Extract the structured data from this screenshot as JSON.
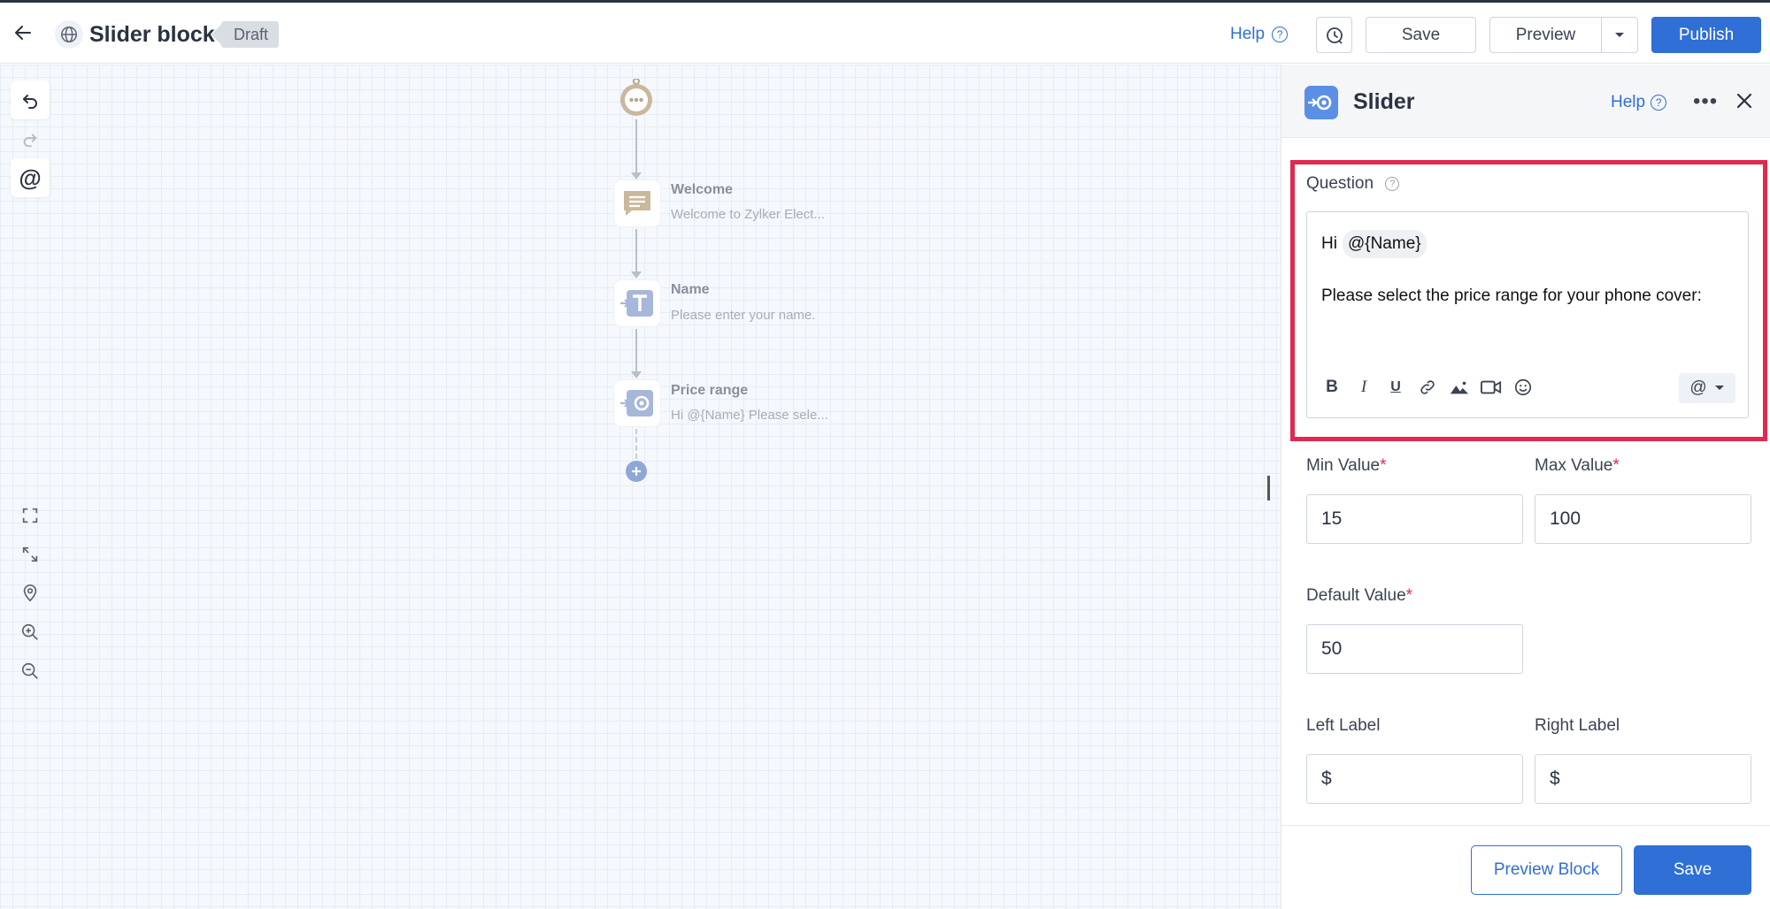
{
  "header": {
    "title": "Slider block",
    "status": "Draft",
    "help_label": "Help",
    "save_label": "Save",
    "preview_label": "Preview",
    "publish_label": "Publish"
  },
  "flow": {
    "nodes": [
      {
        "title": "Welcome",
        "subtitle": "Welcome to Zylker Elect..."
      },
      {
        "title": "Name",
        "subtitle": "Please enter your name."
      },
      {
        "title": "Price range",
        "subtitle": "Hi  @{Name}  Please sele..."
      }
    ]
  },
  "panel": {
    "title": "Slider",
    "help_label": "Help",
    "question": {
      "label": "Question",
      "greeting": "Hi",
      "mention_chip": "@{Name}",
      "body": "Please select the price range for your phone cover:"
    },
    "min_value": {
      "label": "Min Value",
      "value": "15"
    },
    "max_value": {
      "label": "Max Value",
      "value": "100"
    },
    "default_value": {
      "label": "Default Value",
      "value": "50"
    },
    "left_label": {
      "label": "Left Label",
      "value": "$"
    },
    "right_label": {
      "label": "Right Label",
      "value": "$"
    },
    "preview_block_label": "Preview Block",
    "save_label": "Save",
    "required_mark": "*",
    "mention_symbol": "@"
  },
  "colors": {
    "accent": "#2f6fd6",
    "highlight": "#e0294f",
    "required": "#e0294f"
  }
}
